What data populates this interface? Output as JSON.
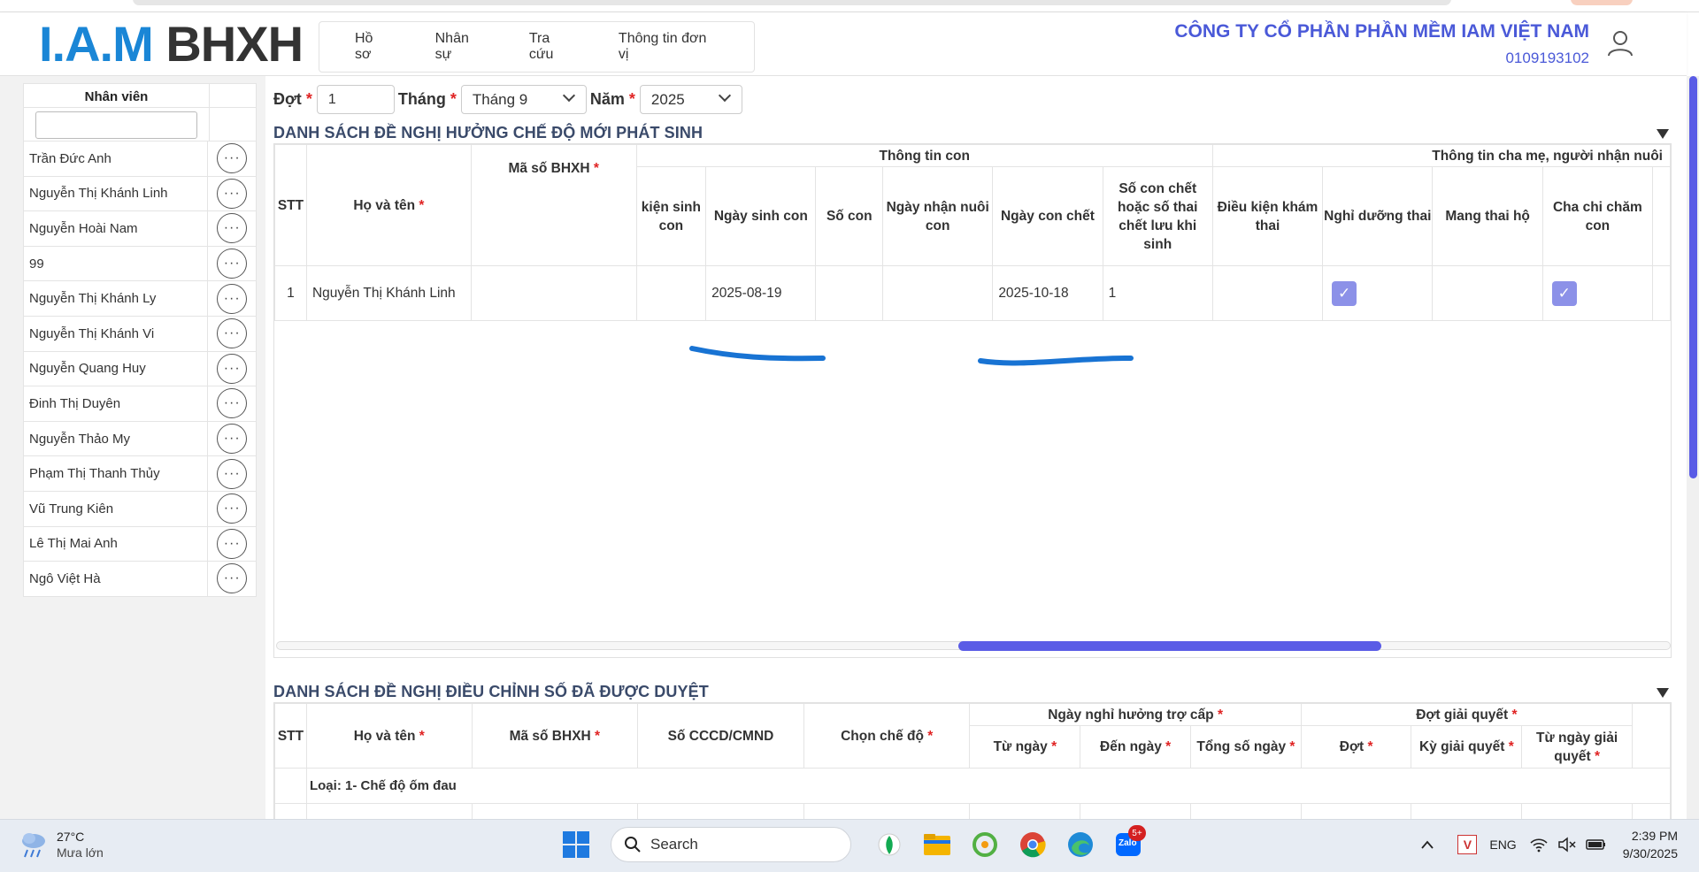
{
  "app": {
    "logo_left": "I.A.M",
    "logo_right": "BHXH",
    "company_name": "CÔNG TY CỔ PHẦN PHẦN MỀM IAM VIỆT NAM",
    "tax_code": "0109193102",
    "nav": [
      "Hồ sơ",
      "Nhân sự",
      "Tra cứu",
      "Thông tin đơn vị"
    ]
  },
  "sidebar": {
    "header": "Nhân viên",
    "search_value": "",
    "employees": [
      "Trần Đức Anh",
      "Nguyễn Thị Khánh Linh",
      "Nguyễn Hoài Nam",
      "99",
      "Nguyễn Thị Khánh Ly",
      "Nguyễn Thị Khánh Vi",
      "Nguyễn Quang Huy",
      "Đinh Thị Duyên",
      "Nguyễn Thảo My",
      "Phạm Thị Thanh Thủy",
      "Vũ Trung Kiên",
      "Lê Thị Mai Anh",
      "Ngô Việt Hà"
    ],
    "row_action_glyph": "···"
  },
  "filters": {
    "dot_label": "Đợt",
    "dot_value": "1",
    "month_label": "Tháng",
    "month_value": "Tháng 9",
    "year_label": "Năm",
    "year_value": "2025",
    "required_mark": "*"
  },
  "section1": {
    "title": "DANH SÁCH ĐỀ NGHỊ HƯỞNG CHẾ ĐỘ MỚI PHÁT SINH",
    "group_child": "Thông tin con",
    "group_parent": "Thông tin cha mẹ, người nhận nuôi",
    "col_stt": "STT",
    "col_name": "Họ và tên",
    "col_bhxh": "Mã số BHXH",
    "col_condition_birth": "kiện sinh con",
    "col_birth_date": "Ngày sinh con",
    "col_child_count": "Số con",
    "col_adopt_date": "Ngày nhận nuôi con",
    "col_death_date": "Ngày con chết",
    "col_death_count": "Số con chết hoặc số thai chết lưu khi sinh",
    "col_checkup": "Điều kiện khám thai",
    "col_rest": "Nghỉ dưỡng thai",
    "col_surrogate": "Mang thai hộ",
    "col_father_care": "Cha chi chăm con",
    "row": {
      "stt": "1",
      "name": "Nguyễn Thị Khánh Linh",
      "bhxh": "",
      "birth_date": "2025-08-19",
      "death_date": "2025-10-18",
      "death_count": "1",
      "rest_checked": true,
      "father_care_checked": true
    },
    "check_glyph": "✓"
  },
  "section2": {
    "title": "DANH SÁCH ĐỀ NGHỊ ĐIỀU CHỈNH SỐ ĐÃ ĐƯỢC DUYỆT",
    "col_stt": "STT",
    "col_name": "Họ và tên",
    "col_bhxh": "Mã số BHXH",
    "col_cccd": "Số CCCD/CMND",
    "col_regime": "Chọn chế độ",
    "group_days": "Ngày nghỉ hưởng trợ cấp",
    "col_from": "Từ ngày",
    "col_to": "Đến ngày",
    "col_total": "Tổng số ngày",
    "group_batch": "Đợt giải quyết",
    "col_batch": "Đợt",
    "col_period": "Kỳ giải quyết",
    "col_from_resolve": "Từ ngày giải quyết",
    "category_row": "Loại: 1- Chế độ ốm đau"
  },
  "taskbar": {
    "temp": "27°C",
    "weather": "Mưa lớn",
    "search": "Search",
    "lang": "ENG",
    "time": "2:39 PM",
    "date": "9/30/2025",
    "zalo_badge": "5+",
    "zalo_label": "Zalo"
  },
  "colors": {
    "accent": "#5a5ce6",
    "checkbox": "#8c91e8",
    "company": "#4a59d8",
    "annotation": "#1873d3"
  }
}
